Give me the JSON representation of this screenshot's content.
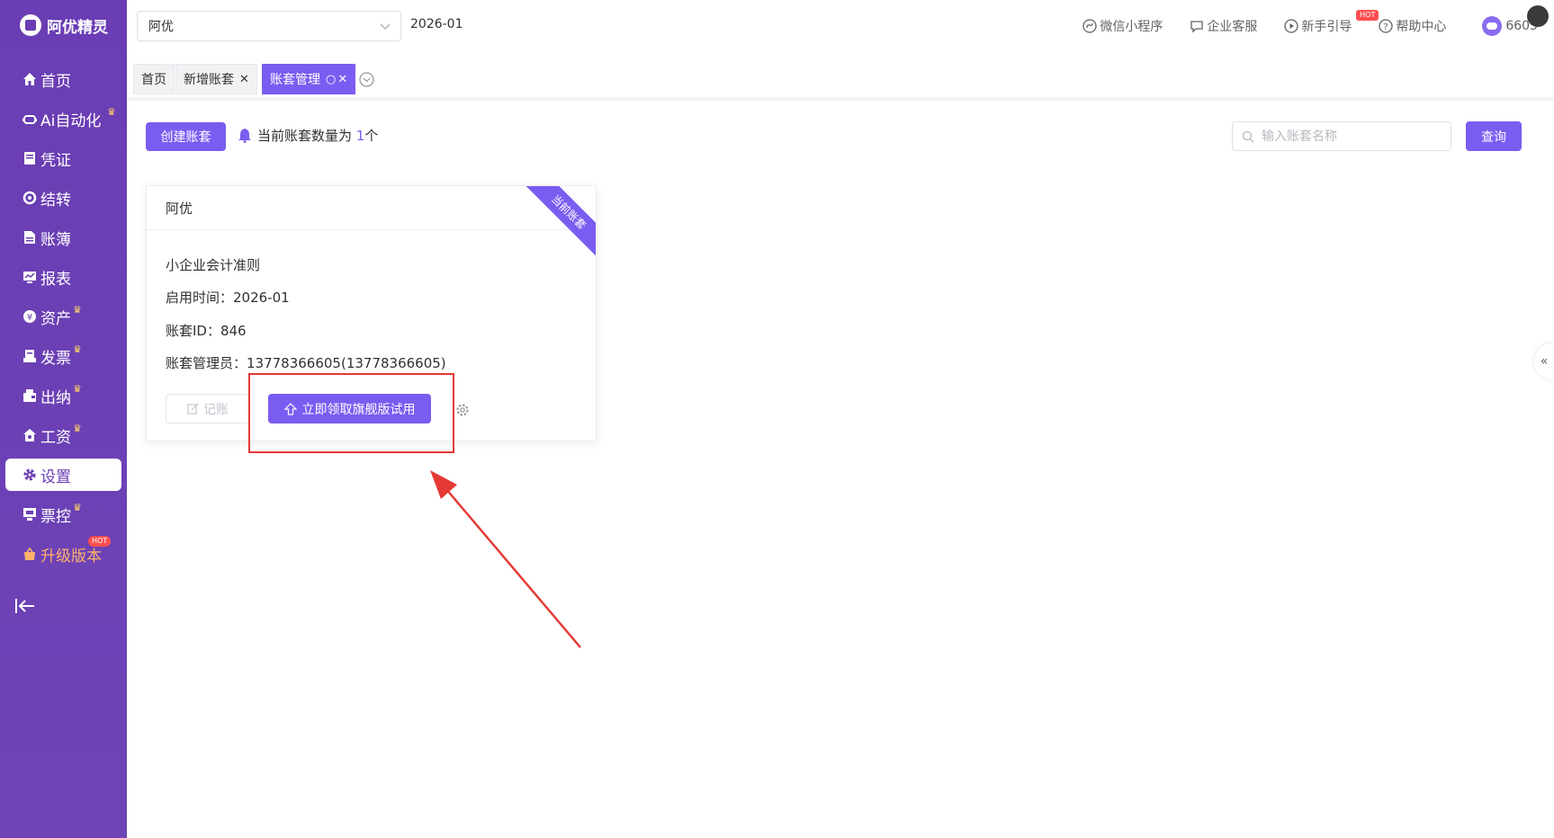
{
  "app": {
    "logo_text": "阿优精灵"
  },
  "sidebar": {
    "items": [
      {
        "label": "首页",
        "icon": "home-icon",
        "crown": false
      },
      {
        "label": "Ai自动化",
        "icon": "robot-icon",
        "crown": true
      },
      {
        "label": "凭证",
        "icon": "voucher-icon",
        "crown": false
      },
      {
        "label": "结转",
        "icon": "transfer-icon",
        "crown": false
      },
      {
        "label": "账簿",
        "icon": "ledger-icon",
        "crown": false
      },
      {
        "label": "报表",
        "icon": "report-icon",
        "crown": false
      },
      {
        "label": "资产",
        "icon": "asset-icon",
        "crown": true
      },
      {
        "label": "发票",
        "icon": "invoice-icon",
        "crown": true
      },
      {
        "label": "出纳",
        "icon": "cashier-icon",
        "crown": true
      },
      {
        "label": "工资",
        "icon": "salary-icon",
        "crown": true
      },
      {
        "label": "设置",
        "icon": "gear-icon",
        "crown": false,
        "active": true
      },
      {
        "label": "票控",
        "icon": "ticket-control-icon",
        "crown": true
      },
      {
        "label": "升级版本",
        "icon": "upgrade-icon",
        "crown": false,
        "badge": "HOT"
      }
    ]
  },
  "topbar": {
    "account_select": "阿优",
    "period": "2026-01",
    "links": {
      "miniprogram": "微信小程序",
      "service": "企业客服",
      "guide": "新手引导",
      "guide_badge": "HOT",
      "help": "帮助中心"
    },
    "user": "6605"
  },
  "tabs": [
    {
      "label": "首页",
      "closable": false
    },
    {
      "label": "新增账套",
      "closable": true
    },
    {
      "label": "账套管理",
      "closable": true,
      "active": true
    }
  ],
  "toolbar": {
    "create_button": "创建账套",
    "notice_prefix": "当前账套数量为 ",
    "notice_count": "1",
    "notice_suffix": "个",
    "search_placeholder": "输入账套名称",
    "search_button": "查询"
  },
  "card": {
    "name": "阿优",
    "ribbon": "当前账套",
    "standard": "小企业会计准则",
    "start_time": "启用时间：2026-01",
    "id": "账套ID：846",
    "admin": "账套管理员：13778366605(13778366605)",
    "bookkeeping_button": "记账",
    "trial_button": "立即领取旗舰版试用"
  },
  "colors": {
    "sidebar": "#6a3db4",
    "accent": "#7b5cf0",
    "annotation": "#e53935"
  }
}
